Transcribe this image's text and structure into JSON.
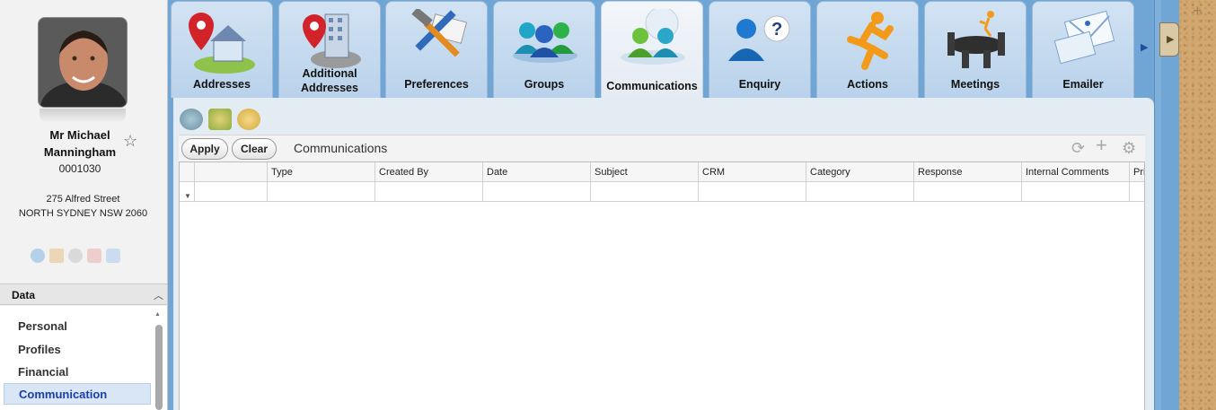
{
  "contact": {
    "name": "Mr Michael Manningham",
    "id": "0001030",
    "address_line1": "275 Alfred Street",
    "address_line2": "NORTH SYDNEY NSW 2060"
  },
  "sidebar": {
    "section_title": "Data",
    "items": [
      {
        "label": "Personal"
      },
      {
        "label": "Profiles"
      },
      {
        "label": "Financial"
      },
      {
        "label": "Communication"
      }
    ]
  },
  "tabs": [
    {
      "label": "Addresses",
      "icon": "map-pin-house-icon"
    },
    {
      "label": "Additional Addresses",
      "icon": "map-pin-building-icon"
    },
    {
      "label": "Preferences",
      "icon": "tools-icon"
    },
    {
      "label": "Groups",
      "icon": "people-group-icon"
    },
    {
      "label": "Communications",
      "icon": "people-chat-icon"
    },
    {
      "label": "Enquiry",
      "icon": "person-question-icon"
    },
    {
      "label": "Actions",
      "icon": "running-man-icon"
    },
    {
      "label": "Meetings",
      "icon": "meeting-table-icon"
    },
    {
      "label": "Emailer",
      "icon": "envelope-icon"
    }
  ],
  "toolbar": {
    "apply_label": "Apply",
    "clear_label": "Clear",
    "title": "Communications"
  },
  "grid": {
    "columns": [
      "",
      "Type",
      "Created By",
      "Date",
      "Subject",
      "CRM",
      "Category",
      "Response",
      "Internal Comments",
      "Pri"
    ]
  },
  "colors": {
    "tab_active_bg": "#f3f6fa",
    "tab_bg": "#c5dbf0",
    "selected_nav_text": "#1a3fa8",
    "frame_blue": "#6fa6d6"
  }
}
